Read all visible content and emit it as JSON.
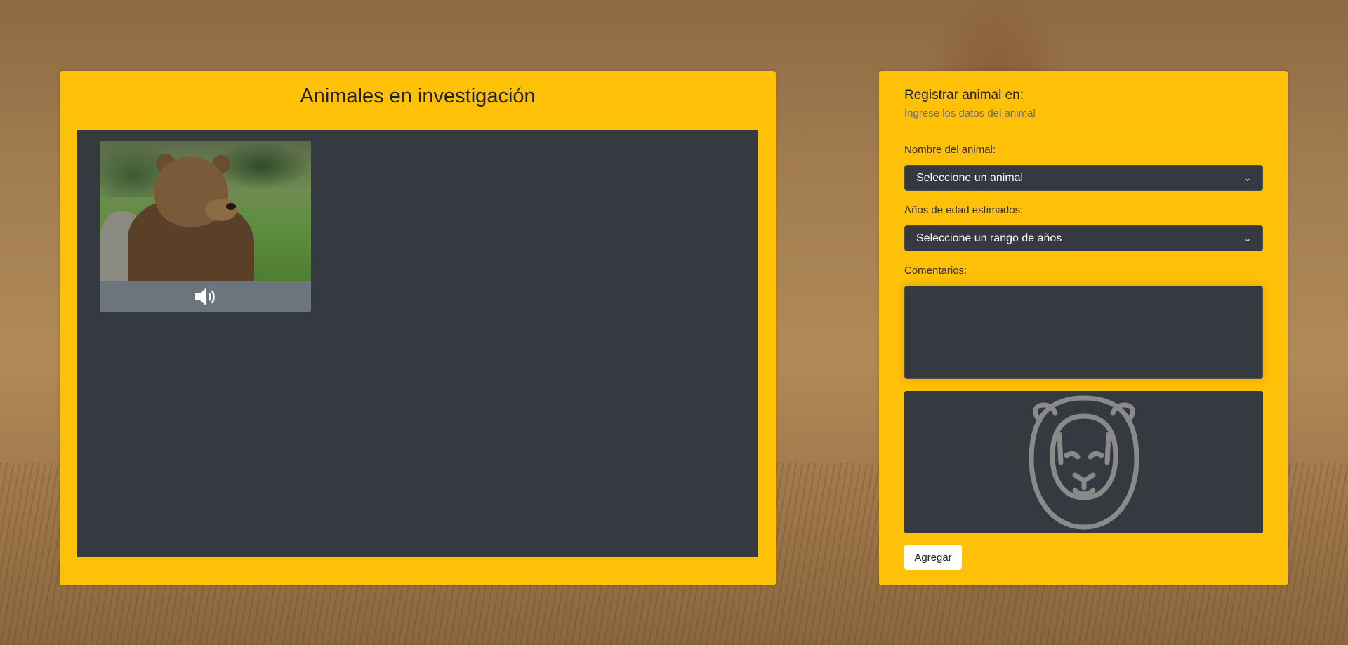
{
  "left_panel": {
    "title": "Animales en investigación",
    "cards": [
      {
        "image_alt": "bear",
        "sound_icon": "volume-up-icon"
      }
    ]
  },
  "form": {
    "title": "Registrar animal en:",
    "subtitle": "Ingrese los datos del animal",
    "animal_label": "Nombre del animal:",
    "animal_select_value": "Seleccione un animal",
    "age_label": "Años de edad estimados:",
    "age_select_value": "Seleccione un rango de años",
    "comments_label": "Comentarios:",
    "comments_value": "",
    "preview_icon": "lion-icon",
    "add_button": "Agregar"
  },
  "colors": {
    "panel": "#ffc107",
    "stage": "#343a40",
    "sound_button": "#6c757d",
    "preview_icon": "#8a8a8a"
  }
}
